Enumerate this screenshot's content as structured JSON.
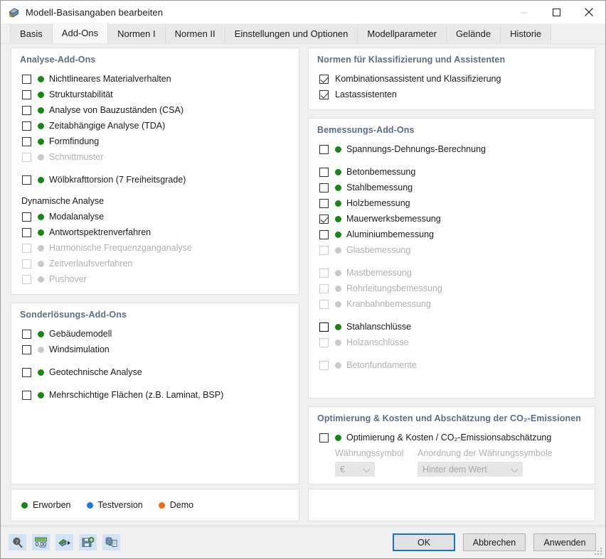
{
  "window": {
    "title": "Modell-Basisangaben bearbeiten",
    "app_icon": "model-base-data-icon",
    "minimize": "minimize-icon",
    "maximize": "maximize-icon",
    "close": "close-icon"
  },
  "tabs": [
    {
      "label": "Basis",
      "active": false
    },
    {
      "label": "Add-Ons",
      "active": true
    },
    {
      "label": "Normen I",
      "active": false
    },
    {
      "label": "Normen II",
      "active": false
    },
    {
      "label": "Einstellungen und Optionen",
      "active": false
    },
    {
      "label": "Modellparameter",
      "active": false
    },
    {
      "label": "Gelände",
      "active": false
    },
    {
      "label": "Historie",
      "active": false
    }
  ],
  "groups": {
    "analyse": {
      "title": "Analyse-Add-Ons",
      "items": [
        {
          "label": "Nichtlineares Materialverhalten",
          "checked": false,
          "dot": "green",
          "enabled": true
        },
        {
          "label": "Strukturstabilität",
          "checked": false,
          "dot": "green",
          "enabled": true
        },
        {
          "label": "Analyse von Bauzuständen (CSA)",
          "checked": false,
          "dot": "green",
          "enabled": true
        },
        {
          "label": "Zeitabhängige Analyse (TDA)",
          "checked": false,
          "dot": "green",
          "enabled": true
        },
        {
          "label": "Formfindung",
          "checked": false,
          "dot": "green",
          "enabled": true
        },
        {
          "label": "Schnittmuster",
          "checked": false,
          "dot": "grey",
          "enabled": false
        },
        {
          "label": "Wölbkrafttorsion (7 Freiheitsgrade)",
          "checked": false,
          "dot": "green",
          "enabled": true,
          "gap_top": true
        }
      ],
      "subsection": {
        "title": "Dynamische Analyse",
        "items": [
          {
            "label": "Modalanalyse",
            "checked": false,
            "dot": "green",
            "enabled": true
          },
          {
            "label": "Antwortspektrenverfahren",
            "checked": false,
            "dot": "green",
            "enabled": true
          },
          {
            "label": "Harmonische Frequenzganganalyse",
            "checked": false,
            "dot": "grey",
            "enabled": false
          },
          {
            "label": "Zeitverlaufsverfahren",
            "checked": false,
            "dot": "grey",
            "enabled": false
          },
          {
            "label": "Pushover",
            "checked": false,
            "dot": "grey",
            "enabled": false
          }
        ]
      }
    },
    "sonderloesungs": {
      "title": "Sonderlösungs-Add-Ons",
      "items": [
        {
          "label": "Gebäudemodell",
          "checked": false,
          "dot": "green",
          "enabled": true
        },
        {
          "label": "Windsimulation",
          "checked": false,
          "dot": "grey",
          "enabled": true
        },
        {
          "label": "Geotechnische Analyse",
          "checked": false,
          "dot": "green",
          "enabled": true,
          "gap_top": true
        },
        {
          "label": "Mehrschichtige Flächen (z.B. Laminat, BSP)",
          "checked": false,
          "dot": "green",
          "enabled": true,
          "gap_top": true
        }
      ]
    },
    "normen": {
      "title": "Normen für Klassifizierung und Assistenten",
      "items": [
        {
          "label": "Kombinationsassistent und Klassifizierung",
          "checked": true,
          "dot": "none",
          "enabled": true
        },
        {
          "label": "Lastassistenten",
          "checked": true,
          "dot": "none",
          "enabled": true
        }
      ]
    },
    "bemessungs": {
      "title": "Bemessungs-Add-Ons",
      "items": [
        {
          "label": "Spannungs-Dehnungs-Berechnung",
          "checked": false,
          "dot": "green",
          "enabled": true
        },
        {
          "label": "Betonbemessung",
          "checked": false,
          "dot": "green",
          "enabled": true,
          "gap_top": true
        },
        {
          "label": "Stahlbemessung",
          "checked": false,
          "dot": "green",
          "enabled": true
        },
        {
          "label": "Holzbemessung",
          "checked": false,
          "dot": "green",
          "enabled": true
        },
        {
          "label": "Mauerwerksbemessung",
          "checked": true,
          "dot": "green",
          "enabled": true
        },
        {
          "label": "Aluminiumbemessung",
          "checked": false,
          "dot": "green",
          "enabled": true
        },
        {
          "label": "Glasbemessung",
          "checked": false,
          "dot": "grey",
          "enabled": false
        },
        {
          "label": "Mastbemessung",
          "checked": false,
          "dot": "grey",
          "enabled": false,
          "gap_top": true
        },
        {
          "label": "Rohrleitungsbemessung",
          "checked": false,
          "dot": "grey",
          "enabled": false
        },
        {
          "label": "Kranbahnbemessung",
          "checked": false,
          "dot": "grey",
          "enabled": false
        },
        {
          "label": "Stahlanschlüsse",
          "checked": false,
          "dot": "green",
          "enabled": true,
          "focused": true,
          "gap_top": true
        },
        {
          "label": "Holzanschlüsse",
          "checked": false,
          "dot": "grey",
          "enabled": false
        },
        {
          "label": "Betonfundamente",
          "checked": false,
          "dot": "grey",
          "enabled": false,
          "gap_top": true
        }
      ]
    },
    "optimierung": {
      "title": "Optimierung & Kosten und Abschätzung der CO₂-Emissionen",
      "items": [
        {
          "label": "Optimierung & Kosten / CO₂-Emissionsabschätzung",
          "checked": false,
          "dot": "green",
          "enabled": true
        }
      ],
      "fields": {
        "currency_symbol_label": "Währungssymbol",
        "currency_symbol_value": "€",
        "currency_order_label": "Anordnung der Währungssymbole",
        "currency_order_value": "Hinter dem Wert"
      }
    }
  },
  "legend": [
    {
      "label": "Erworben",
      "dot": "green"
    },
    {
      "label": "Testversion",
      "dot": "blue"
    },
    {
      "label": "Demo",
      "dot": "orange"
    }
  ],
  "footer": {
    "tools": [
      "help-magnifier-icon",
      "units-ruler-icon",
      "export-arrow-icon",
      "save-settings-icon",
      "database-document-icon"
    ],
    "ok_label": "OK",
    "cancel_label": "Abbrechen",
    "apply_label": "Anwenden"
  },
  "colors": {
    "accent": "#1673c6",
    "group_title": "#5a6e8c",
    "green": "#14880f",
    "blue": "#1b7ae0",
    "orange": "#f36c10",
    "grey": "#c9c9c9"
  }
}
